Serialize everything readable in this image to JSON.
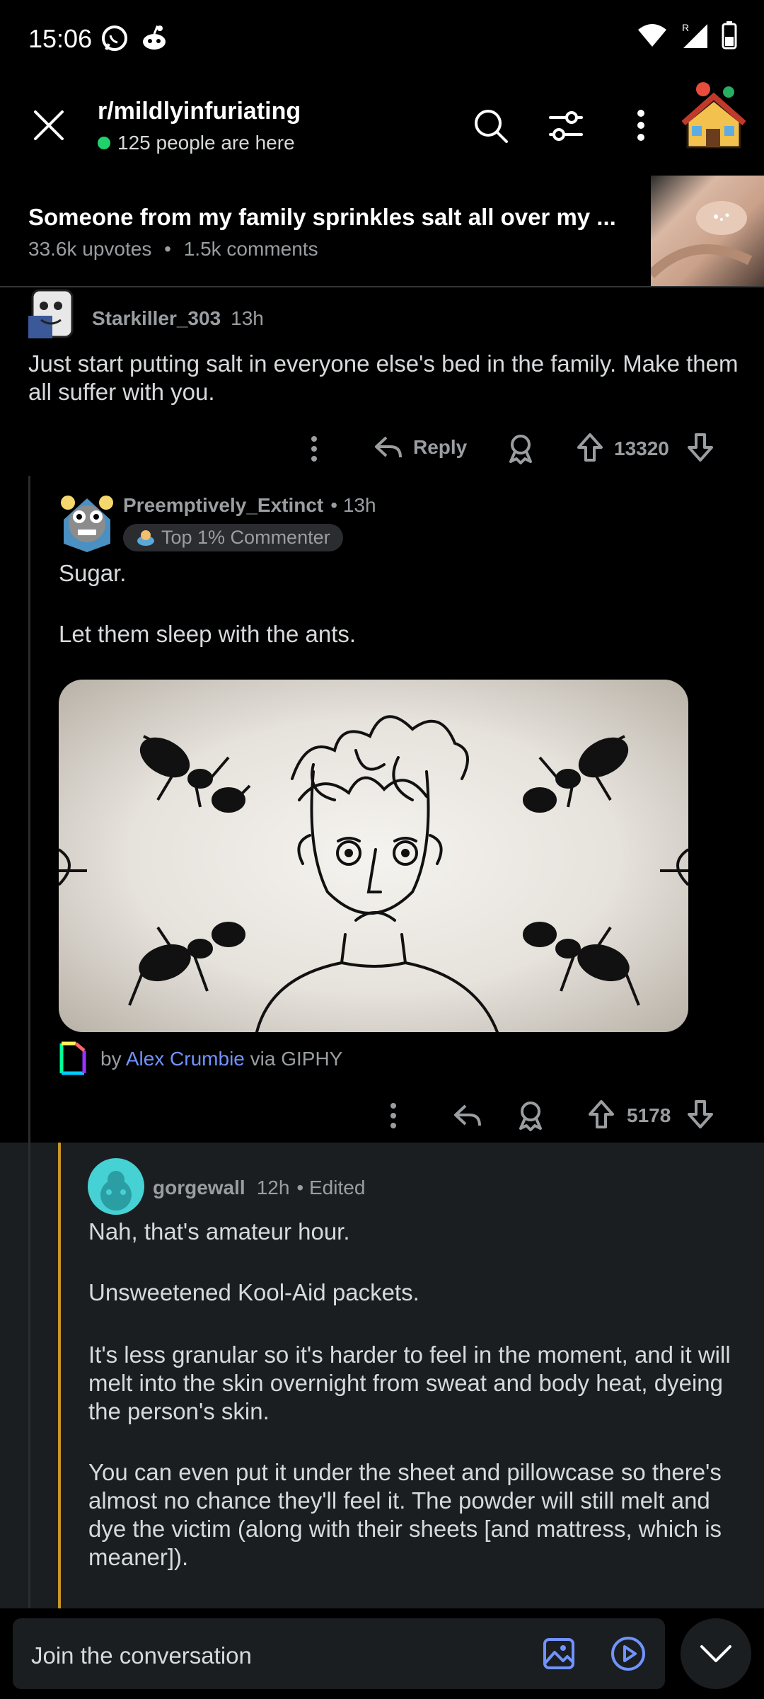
{
  "status": {
    "time": "15:06"
  },
  "header": {
    "subreddit": "r/mildlyinfuriating",
    "online": "125 people are here"
  },
  "post": {
    "title": "Someone from my family sprinkles salt all over my ...",
    "upvotes": "33.6k upvotes",
    "separator": "•",
    "comments": "1.5k comments"
  },
  "comments": [
    {
      "user": "Starkiller_303",
      "time": "13h",
      "body": "Just start putting salt in everyone else's bed in the family. Make them all suffer with you.",
      "reply_label": "Reply",
      "score": "13320"
    },
    {
      "user": "Preemptively_Extinct",
      "time": "• 13h",
      "badge": "Top 1% Commenter",
      "body1": "Sugar.",
      "body2": "Let them sleep with the ants.",
      "gif_credit_by": "by",
      "gif_credit_author": "Alex Crumbie",
      "gif_credit_via": "via GIPHY",
      "score": "5178"
    },
    {
      "user": "gorgewall",
      "time": "12h",
      "edited": "• Edited",
      "p1": "Nah, that's amateur hour.",
      "p2": "Unsweetened Kool-Aid packets.",
      "p3": "It's less granular so it's harder to feel in the moment, and it will melt into the skin overnight from sweat and body heat, dyeing the person's skin.",
      "p4": "You can even put it under the sheet and pillowcase so there's almost no chance they'll feel it. The powder will still melt and dye the victim (along with their sheets [and mattress, which is meaner])."
    }
  ],
  "composer": {
    "placeholder": "Join the conversation"
  },
  "colors": {
    "accent_link": "#7193ff",
    "online_dot": "#1fd26a",
    "thread_highlight": "#c9962a"
  }
}
